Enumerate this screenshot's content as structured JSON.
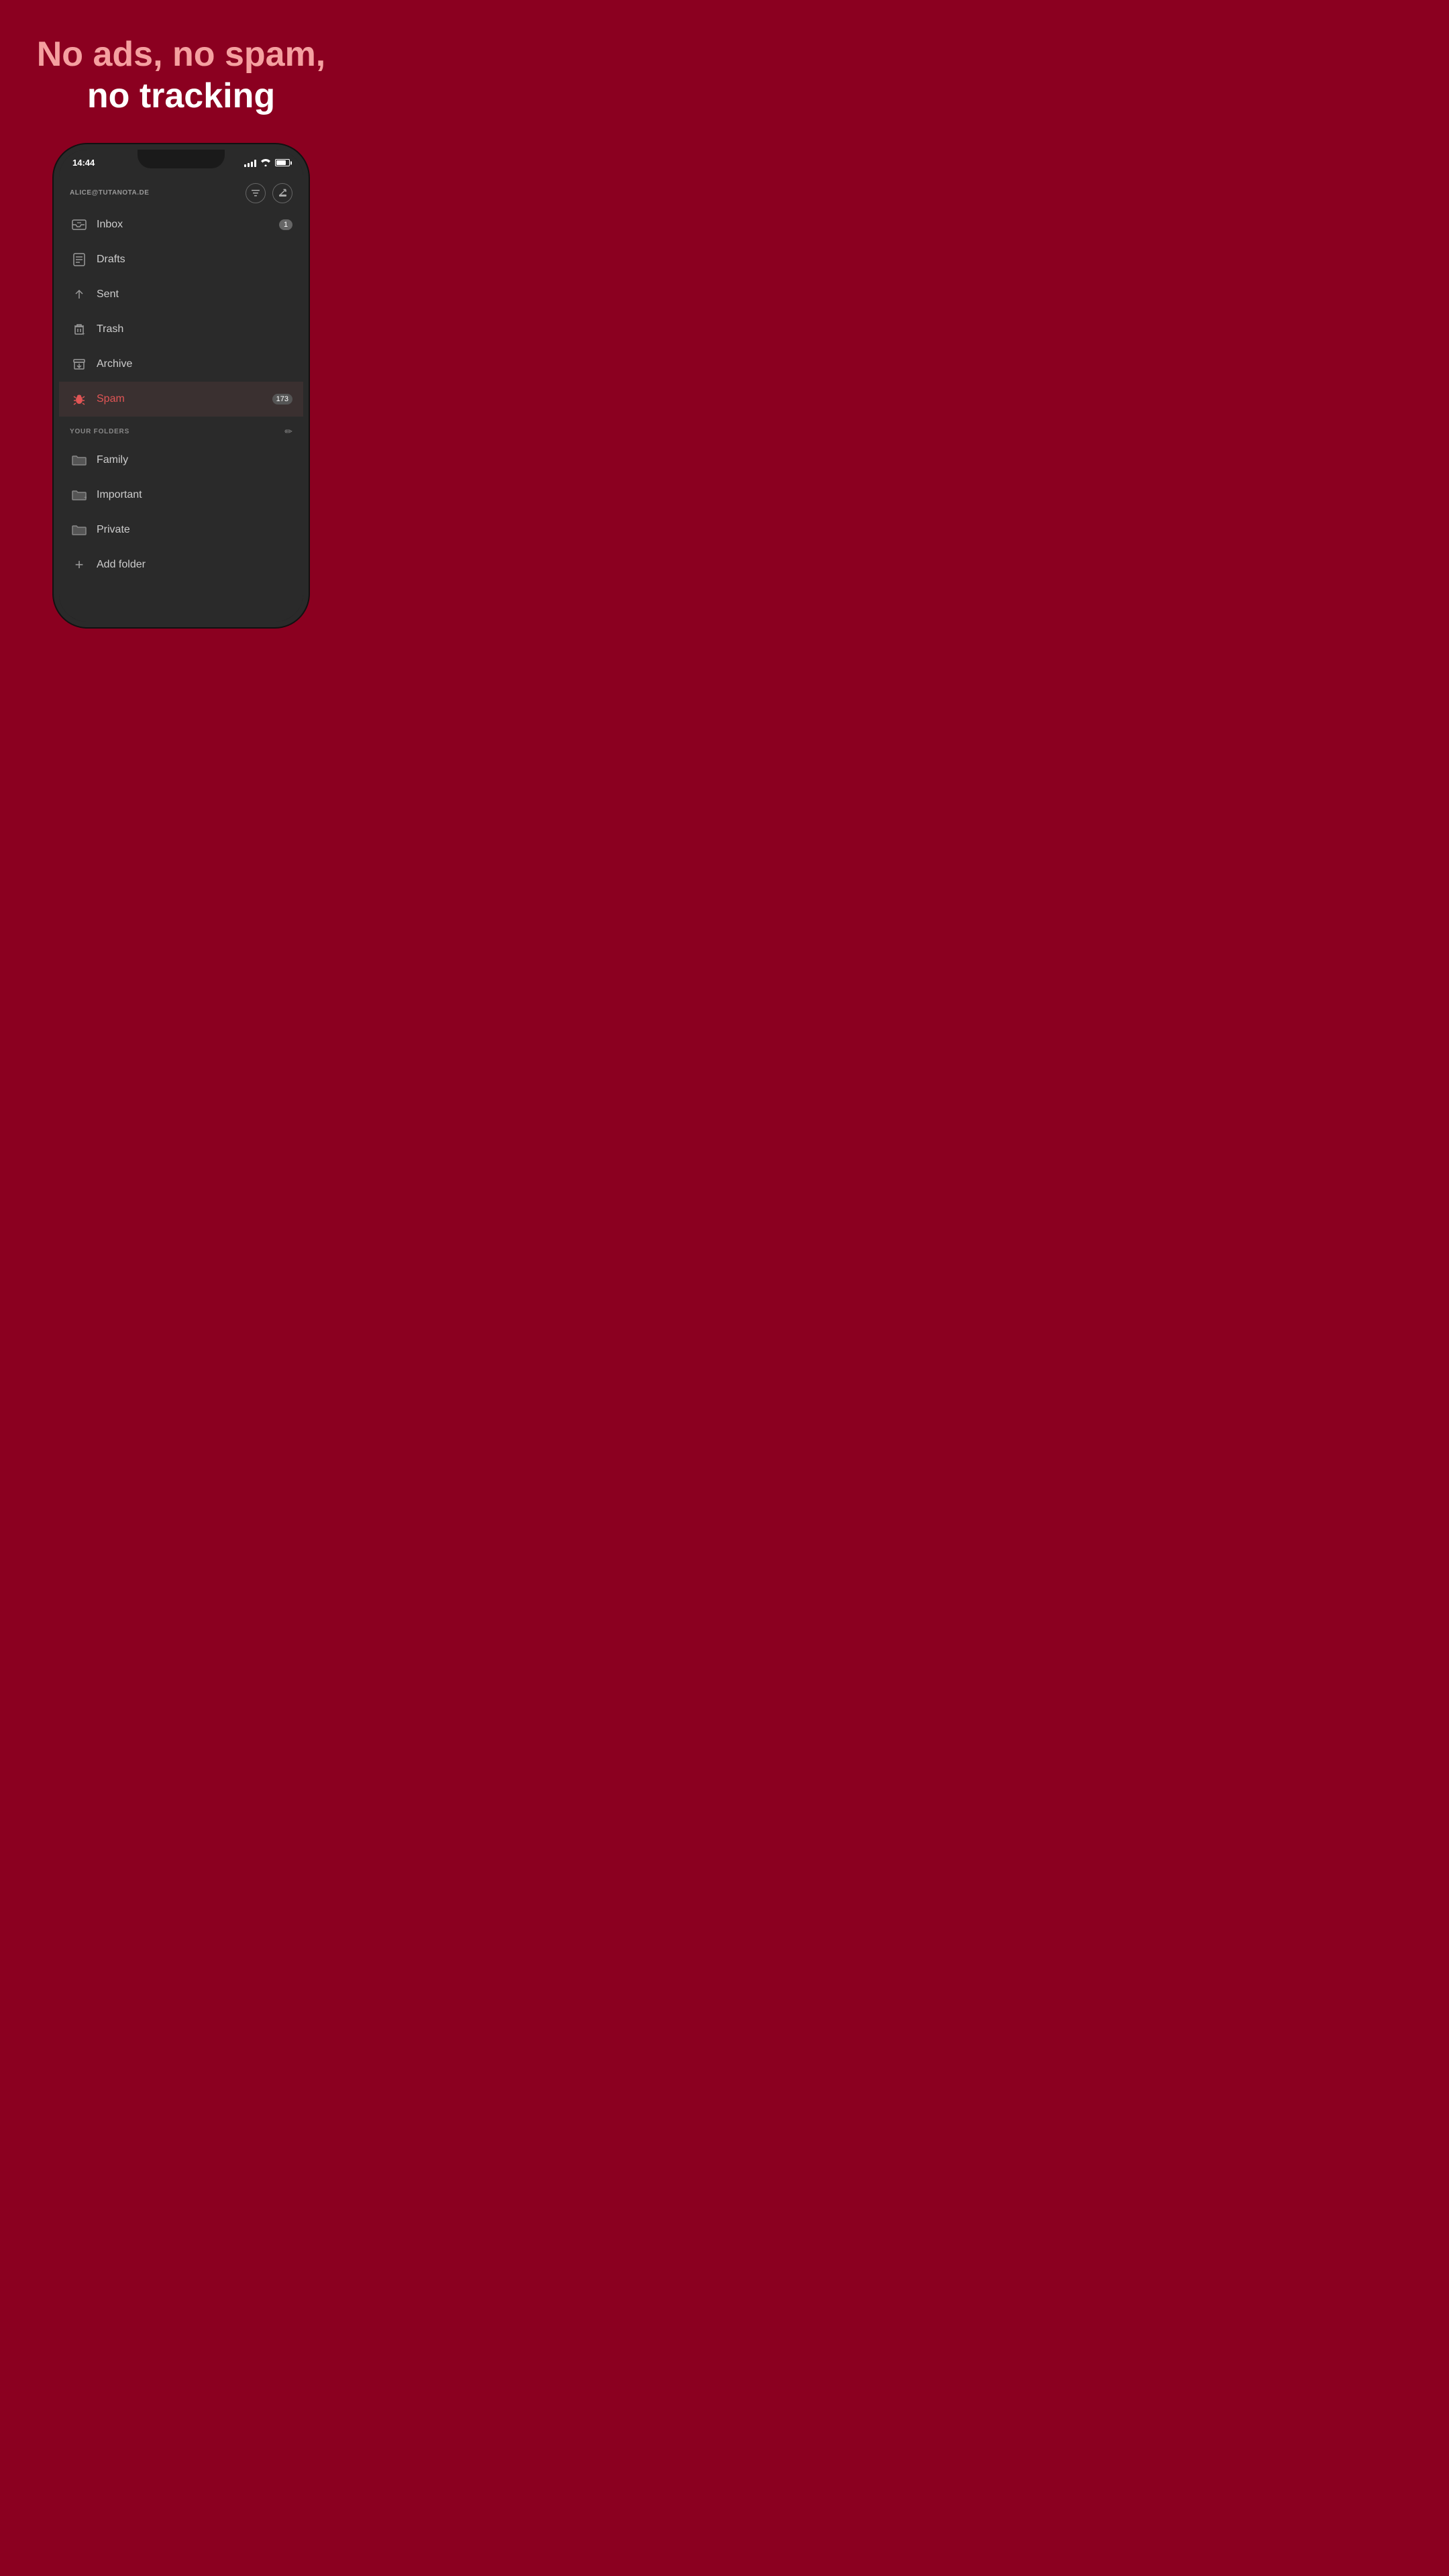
{
  "hero": {
    "line1": "No ads, no spam,",
    "line2": "no tracking"
  },
  "statusBar": {
    "time": "14:44"
  },
  "account": {
    "email": "ALICE@TUTANOTA.DE"
  },
  "navItems": [
    {
      "id": "inbox",
      "label": "Inbox",
      "badge": "1",
      "active": false
    },
    {
      "id": "drafts",
      "label": "Drafts",
      "badge": null,
      "active": false
    },
    {
      "id": "sent",
      "label": "Sent",
      "badge": null,
      "active": false
    },
    {
      "id": "trash",
      "label": "Trash",
      "badge": null,
      "active": false
    },
    {
      "id": "archive",
      "label": "Archive",
      "badge": null,
      "active": false
    },
    {
      "id": "spam",
      "label": "Spam",
      "badge": "173",
      "active": true
    }
  ],
  "foldersSection": {
    "title": "YOUR FOLDERS",
    "items": [
      {
        "id": "family",
        "label": "Family"
      },
      {
        "id": "important",
        "label": "Important"
      },
      {
        "id": "private",
        "label": "Private"
      }
    ],
    "addLabel": "Add folder"
  }
}
